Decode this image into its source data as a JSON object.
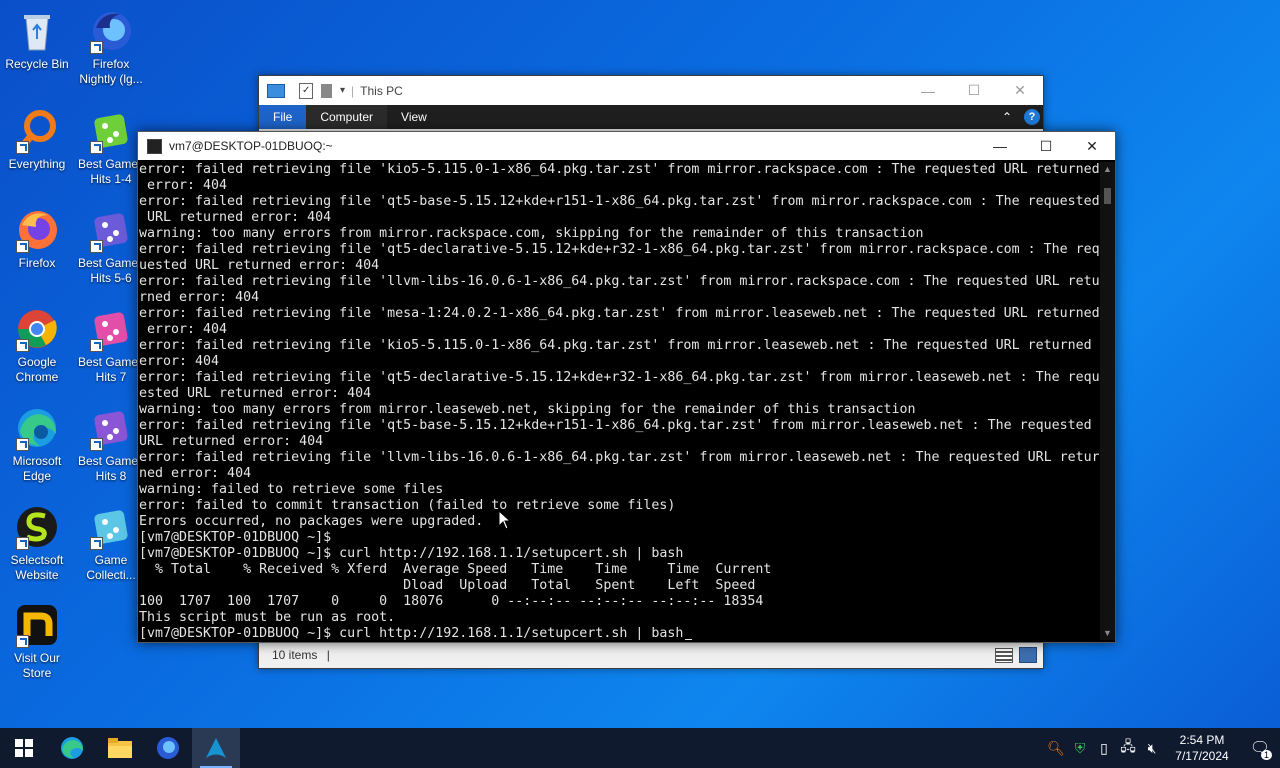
{
  "desktop": {
    "icons": [
      {
        "label": "Recycle Bin"
      },
      {
        "label": "Firefox Nightly (lg..."
      },
      {
        "label": "Everything"
      },
      {
        "label": "Best Games Hits 1-4"
      },
      {
        "label": "Firefox"
      },
      {
        "label": "Best Games Hits 5-6"
      },
      {
        "label": "Google Chrome"
      },
      {
        "label": "Best Games Hits 7"
      },
      {
        "label": "Microsoft Edge"
      },
      {
        "label": "Best Games Hits 8"
      },
      {
        "label": "Selectsoft Website"
      },
      {
        "label": "Game Collecti..."
      },
      {
        "label": "Visit Our Store"
      }
    ]
  },
  "explorer": {
    "title": "This PC",
    "tabs": [
      "File",
      "Computer",
      "View"
    ],
    "status": "10 items"
  },
  "terminal": {
    "title": "vm7@DESKTOP-01DBUOQ:~",
    "lines": [
      "error: failed retrieving file 'kio5-5.115.0-1-x86_64.pkg.tar.zst' from mirror.rackspace.com : The requested URL returned",
      " error: 404",
      "error: failed retrieving file 'qt5-base-5.15.12+kde+r151-1-x86_64.pkg.tar.zst' from mirror.rackspace.com : The requested",
      " URL returned error: 404",
      "warning: too many errors from mirror.rackspace.com, skipping for the remainder of this transaction",
      "error: failed retrieving file 'qt5-declarative-5.15.12+kde+r32-1-x86_64.pkg.tar.zst' from mirror.rackspace.com : The req",
      "uested URL returned error: 404",
      "error: failed retrieving file 'llvm-libs-16.0.6-1-x86_64.pkg.tar.zst' from mirror.rackspace.com : The requested URL retu",
      "rned error: 404",
      "error: failed retrieving file 'mesa-1:24.0.2-1-x86_64.pkg.tar.zst' from mirror.leaseweb.net : The requested URL returned",
      " error: 404",
      "error: failed retrieving file 'kio5-5.115.0-1-x86_64.pkg.tar.zst' from mirror.leaseweb.net : The requested URL returned",
      "error: 404",
      "error: failed retrieving file 'qt5-declarative-5.15.12+kde+r32-1-x86_64.pkg.tar.zst' from mirror.leaseweb.net : The requ",
      "ested URL returned error: 404",
      "warning: too many errors from mirror.leaseweb.net, skipping for the remainder of this transaction",
      "error: failed retrieving file 'qt5-base-5.15.12+kde+r151-1-x86_64.pkg.tar.zst' from mirror.leaseweb.net : The requested",
      "URL returned error: 404",
      "error: failed retrieving file 'llvm-libs-16.0.6-1-x86_64.pkg.tar.zst' from mirror.leaseweb.net : The requested URL retur",
      "ned error: 404",
      "warning: failed to retrieve some files",
      "error: failed to commit transaction (failed to retrieve some files)",
      "Errors occurred, no packages were upgraded.",
      "[vm7@DESKTOP-01DBUOQ ~]$",
      "[vm7@DESKTOP-01DBUOQ ~]$ curl http://192.168.1.1/setupcert.sh | bash",
      "  % Total    % Received % Xferd  Average Speed   Time    Time     Time  Current",
      "                                 Dload  Upload   Total   Spent    Left  Speed",
      "100  1707  100  1707    0     0  18076      0 --:--:-- --:--:-- --:--:-- 18354",
      "This script must be run as root.",
      "[vm7@DESKTOP-01DBUOQ ~]$ curl http://192.168.1.1/setupcert.sh | bash"
    ]
  },
  "taskbar": {
    "time": "2:54 PM",
    "date": "7/17/2024",
    "notification_count": "1"
  }
}
